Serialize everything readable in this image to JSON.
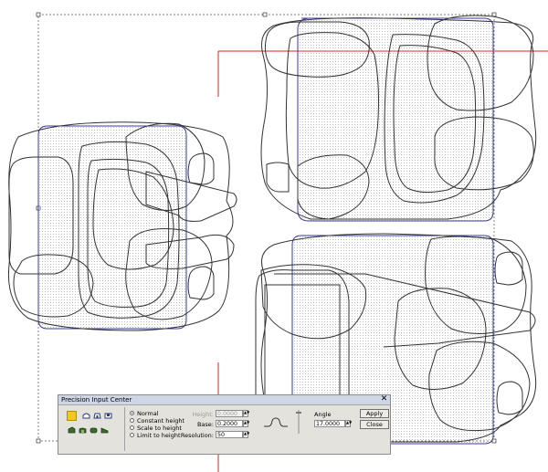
{
  "dialog": {
    "title": "Precision Input Center",
    "close_glyph": "✕",
    "swatch_color": "#f2c81a",
    "tool_icons": [
      "dome-icon",
      "bevel-icon",
      "channel-icon",
      "ramp-icon",
      "pillow-icon",
      "round-icon",
      "angle-icon"
    ],
    "modes": [
      {
        "label": "Normal",
        "selected": true
      },
      {
        "label": "Constant height",
        "selected": false
      },
      {
        "label": "Scale to height",
        "selected": false
      },
      {
        "label": "Limit to height",
        "selected": false
      }
    ],
    "fields": {
      "height_label": "Height:",
      "height_value": "0.0000",
      "base_label": "Base:",
      "base_value": "0.2000",
      "resolution_label": "Resolution:",
      "resolution_value": "50",
      "angle_label": "Angle",
      "angle_value": "17.0000"
    },
    "buttons": {
      "apply": "Apply",
      "close": "Close"
    }
  },
  "colors": {
    "outline": "#333333",
    "selection": "#3a3aa8",
    "guide": "#e02020",
    "fill_dots": "#bfbfbf"
  }
}
